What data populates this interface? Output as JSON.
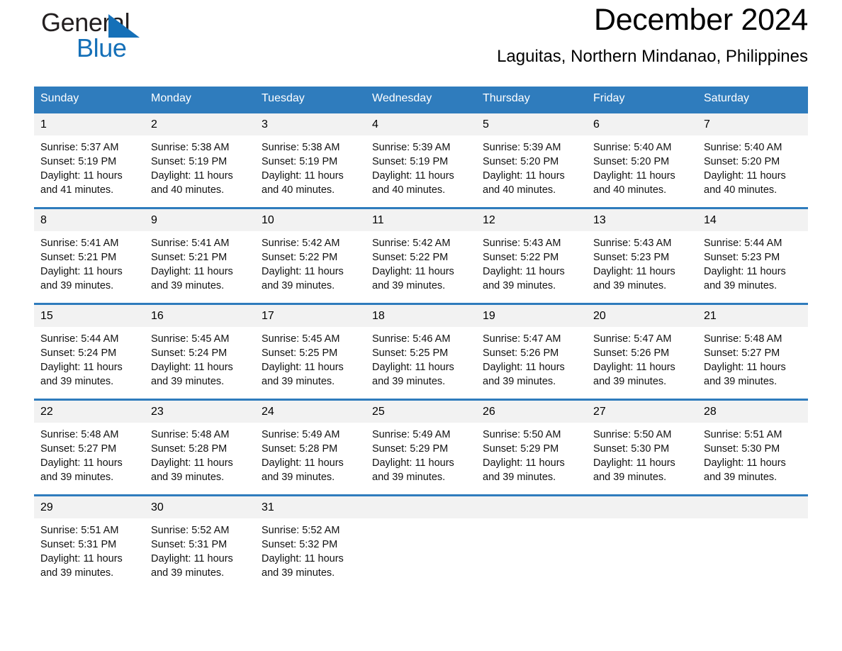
{
  "brand": {
    "name_part1": "General",
    "name_part2": "Blue",
    "logo_icon": "triangle-logo-icon",
    "accent_color": "#1570b8"
  },
  "header": {
    "month_title": "December 2024",
    "location": "Laguitas, Northern Mindanao, Philippines"
  },
  "theme": {
    "header_blue": "#2f7cbd",
    "day_band_gray": "#f2f2f2",
    "text_black": "#000000"
  },
  "calendar": {
    "weekday_headers": [
      "Sunday",
      "Monday",
      "Tuesday",
      "Wednesday",
      "Thursday",
      "Friday",
      "Saturday"
    ],
    "weeks": [
      [
        {
          "day": "1",
          "sunrise": "Sunrise: 5:37 AM",
          "sunset": "Sunset: 5:19 PM",
          "daylight_1": "Daylight: 11 hours",
          "daylight_2": "and 41 minutes."
        },
        {
          "day": "2",
          "sunrise": "Sunrise: 5:38 AM",
          "sunset": "Sunset: 5:19 PM",
          "daylight_1": "Daylight: 11 hours",
          "daylight_2": "and 40 minutes."
        },
        {
          "day": "3",
          "sunrise": "Sunrise: 5:38 AM",
          "sunset": "Sunset: 5:19 PM",
          "daylight_1": "Daylight: 11 hours",
          "daylight_2": "and 40 minutes."
        },
        {
          "day": "4",
          "sunrise": "Sunrise: 5:39 AM",
          "sunset": "Sunset: 5:19 PM",
          "daylight_1": "Daylight: 11 hours",
          "daylight_2": "and 40 minutes."
        },
        {
          "day": "5",
          "sunrise": "Sunrise: 5:39 AM",
          "sunset": "Sunset: 5:20 PM",
          "daylight_1": "Daylight: 11 hours",
          "daylight_2": "and 40 minutes."
        },
        {
          "day": "6",
          "sunrise": "Sunrise: 5:40 AM",
          "sunset": "Sunset: 5:20 PM",
          "daylight_1": "Daylight: 11 hours",
          "daylight_2": "and 40 minutes."
        },
        {
          "day": "7",
          "sunrise": "Sunrise: 5:40 AM",
          "sunset": "Sunset: 5:20 PM",
          "daylight_1": "Daylight: 11 hours",
          "daylight_2": "and 40 minutes."
        }
      ],
      [
        {
          "day": "8",
          "sunrise": "Sunrise: 5:41 AM",
          "sunset": "Sunset: 5:21 PM",
          "daylight_1": "Daylight: 11 hours",
          "daylight_2": "and 39 minutes."
        },
        {
          "day": "9",
          "sunrise": "Sunrise: 5:41 AM",
          "sunset": "Sunset: 5:21 PM",
          "daylight_1": "Daylight: 11 hours",
          "daylight_2": "and 39 minutes."
        },
        {
          "day": "10",
          "sunrise": "Sunrise: 5:42 AM",
          "sunset": "Sunset: 5:22 PM",
          "daylight_1": "Daylight: 11 hours",
          "daylight_2": "and 39 minutes."
        },
        {
          "day": "11",
          "sunrise": "Sunrise: 5:42 AM",
          "sunset": "Sunset: 5:22 PM",
          "daylight_1": "Daylight: 11 hours",
          "daylight_2": "and 39 minutes."
        },
        {
          "day": "12",
          "sunrise": "Sunrise: 5:43 AM",
          "sunset": "Sunset: 5:22 PM",
          "daylight_1": "Daylight: 11 hours",
          "daylight_2": "and 39 minutes."
        },
        {
          "day": "13",
          "sunrise": "Sunrise: 5:43 AM",
          "sunset": "Sunset: 5:23 PM",
          "daylight_1": "Daylight: 11 hours",
          "daylight_2": "and 39 minutes."
        },
        {
          "day": "14",
          "sunrise": "Sunrise: 5:44 AM",
          "sunset": "Sunset: 5:23 PM",
          "daylight_1": "Daylight: 11 hours",
          "daylight_2": "and 39 minutes."
        }
      ],
      [
        {
          "day": "15",
          "sunrise": "Sunrise: 5:44 AM",
          "sunset": "Sunset: 5:24 PM",
          "daylight_1": "Daylight: 11 hours",
          "daylight_2": "and 39 minutes."
        },
        {
          "day": "16",
          "sunrise": "Sunrise: 5:45 AM",
          "sunset": "Sunset: 5:24 PM",
          "daylight_1": "Daylight: 11 hours",
          "daylight_2": "and 39 minutes."
        },
        {
          "day": "17",
          "sunrise": "Sunrise: 5:45 AM",
          "sunset": "Sunset: 5:25 PM",
          "daylight_1": "Daylight: 11 hours",
          "daylight_2": "and 39 minutes."
        },
        {
          "day": "18",
          "sunrise": "Sunrise: 5:46 AM",
          "sunset": "Sunset: 5:25 PM",
          "daylight_1": "Daylight: 11 hours",
          "daylight_2": "and 39 minutes."
        },
        {
          "day": "19",
          "sunrise": "Sunrise: 5:47 AM",
          "sunset": "Sunset: 5:26 PM",
          "daylight_1": "Daylight: 11 hours",
          "daylight_2": "and 39 minutes."
        },
        {
          "day": "20",
          "sunrise": "Sunrise: 5:47 AM",
          "sunset": "Sunset: 5:26 PM",
          "daylight_1": "Daylight: 11 hours",
          "daylight_2": "and 39 minutes."
        },
        {
          "day": "21",
          "sunrise": "Sunrise: 5:48 AM",
          "sunset": "Sunset: 5:27 PM",
          "daylight_1": "Daylight: 11 hours",
          "daylight_2": "and 39 minutes."
        }
      ],
      [
        {
          "day": "22",
          "sunrise": "Sunrise: 5:48 AM",
          "sunset": "Sunset: 5:27 PM",
          "daylight_1": "Daylight: 11 hours",
          "daylight_2": "and 39 minutes."
        },
        {
          "day": "23",
          "sunrise": "Sunrise: 5:48 AM",
          "sunset": "Sunset: 5:28 PM",
          "daylight_1": "Daylight: 11 hours",
          "daylight_2": "and 39 minutes."
        },
        {
          "day": "24",
          "sunrise": "Sunrise: 5:49 AM",
          "sunset": "Sunset: 5:28 PM",
          "daylight_1": "Daylight: 11 hours",
          "daylight_2": "and 39 minutes."
        },
        {
          "day": "25",
          "sunrise": "Sunrise: 5:49 AM",
          "sunset": "Sunset: 5:29 PM",
          "daylight_1": "Daylight: 11 hours",
          "daylight_2": "and 39 minutes."
        },
        {
          "day": "26",
          "sunrise": "Sunrise: 5:50 AM",
          "sunset": "Sunset: 5:29 PM",
          "daylight_1": "Daylight: 11 hours",
          "daylight_2": "and 39 minutes."
        },
        {
          "day": "27",
          "sunrise": "Sunrise: 5:50 AM",
          "sunset": "Sunset: 5:30 PM",
          "daylight_1": "Daylight: 11 hours",
          "daylight_2": "and 39 minutes."
        },
        {
          "day": "28",
          "sunrise": "Sunrise: 5:51 AM",
          "sunset": "Sunset: 5:30 PM",
          "daylight_1": "Daylight: 11 hours",
          "daylight_2": "and 39 minutes."
        }
      ],
      [
        {
          "day": "29",
          "sunrise": "Sunrise: 5:51 AM",
          "sunset": "Sunset: 5:31 PM",
          "daylight_1": "Daylight: 11 hours",
          "daylight_2": "and 39 minutes."
        },
        {
          "day": "30",
          "sunrise": "Sunrise: 5:52 AM",
          "sunset": "Sunset: 5:31 PM",
          "daylight_1": "Daylight: 11 hours",
          "daylight_2": "and 39 minutes."
        },
        {
          "day": "31",
          "sunrise": "Sunrise: 5:52 AM",
          "sunset": "Sunset: 5:32 PM",
          "daylight_1": "Daylight: 11 hours",
          "daylight_2": "and 39 minutes."
        },
        {
          "day": "",
          "sunrise": "",
          "sunset": "",
          "daylight_1": "",
          "daylight_2": "",
          "empty": true
        },
        {
          "day": "",
          "sunrise": "",
          "sunset": "",
          "daylight_1": "",
          "daylight_2": "",
          "empty": true
        },
        {
          "day": "",
          "sunrise": "",
          "sunset": "",
          "daylight_1": "",
          "daylight_2": "",
          "empty": true
        },
        {
          "day": "",
          "sunrise": "",
          "sunset": "",
          "daylight_1": "",
          "daylight_2": "",
          "empty": true
        }
      ]
    ]
  }
}
